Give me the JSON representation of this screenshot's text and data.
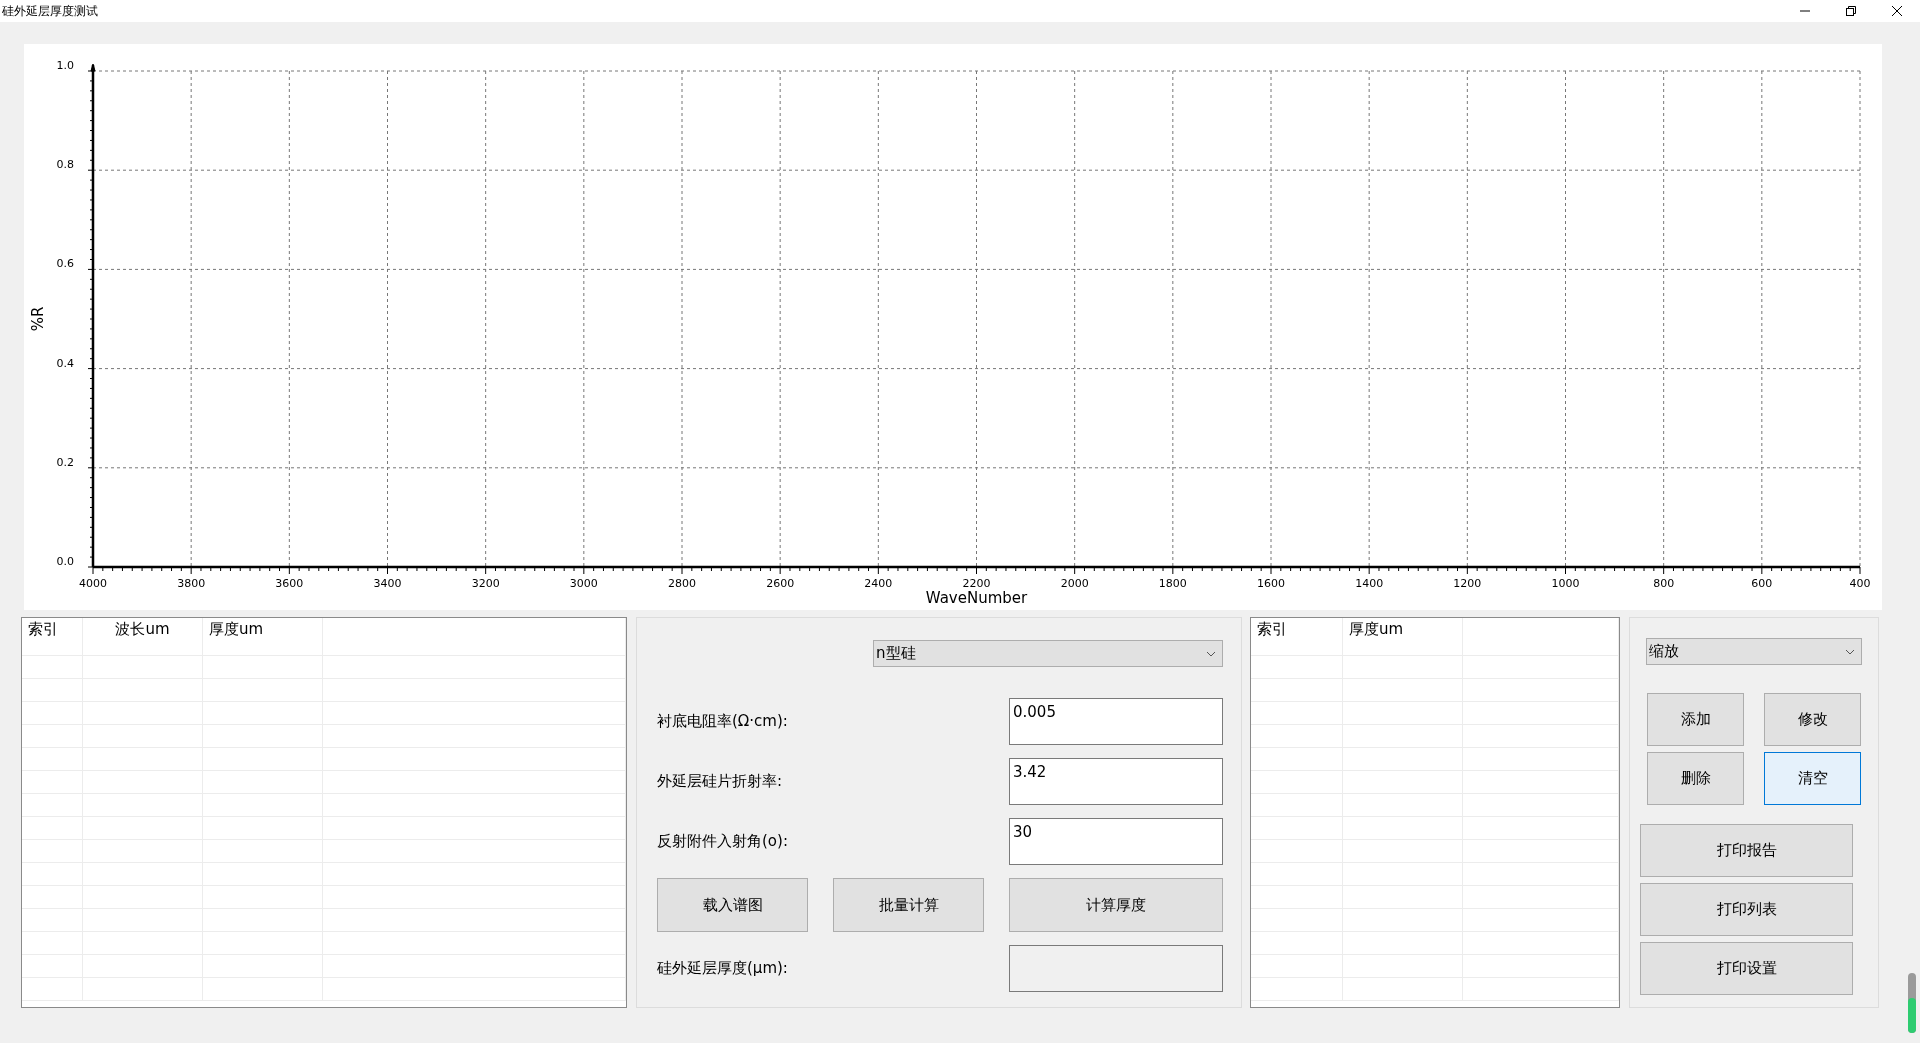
{
  "window": {
    "title": "硅外延层厚度测试"
  },
  "chart": {
    "chart_data": {
      "type": "line",
      "grid": true,
      "xlabel": "WaveNumber",
      "ylabel": "%R",
      "xlim": [
        4000,
        400
      ],
      "ylim": [
        0,
        1
      ],
      "xticks": [
        4000,
        3800,
        3600,
        3400,
        3200,
        3000,
        2800,
        2600,
        2400,
        2200,
        2000,
        1800,
        1600,
        1400,
        1200,
        1000,
        800,
        600,
        400
      ],
      "yticks": [
        {
          "value": 0,
          "label": "0.0"
        },
        {
          "value": 0.2,
          "label": "0.2"
        },
        {
          "value": 0.4,
          "label": "0.4"
        },
        {
          "value": 0.6,
          "label": "0.6"
        },
        {
          "value": 0.8,
          "label": "0.8"
        },
        {
          "value": 1,
          "label": "1.0"
        }
      ]
    }
  },
  "left_table": {
    "columns": [
      "索引",
      "波长um",
      "厚度um"
    ]
  },
  "parameters": {
    "material": "n型硅",
    "fields": [
      {
        "label": "衬底电阻率(Ω·cm):",
        "value": "0.005"
      },
      {
        "label": "外延层硅片折射率:",
        "value": "3.42"
      },
      {
        "label": "反射附件入射角(o):",
        "value": "30"
      }
    ],
    "buttons": [
      "载入谱图",
      "批量计算",
      "计算厚度"
    ],
    "result": {
      "label": "硅外延层厚度(μm):"
    }
  },
  "right_table": {
    "columns": [
      "索引",
      "厚度um"
    ]
  },
  "actions": {
    "mode": "缩放",
    "edit_buttons": [
      {
        "label": "添加",
        "focused": false
      },
      {
        "label": "修改",
        "focused": false
      },
      {
        "label": "删除",
        "focused": false
      },
      {
        "label": "清空",
        "focused": true
      }
    ],
    "print_buttons": [
      "打印报告",
      "打印列表",
      "打印设置"
    ]
  }
}
